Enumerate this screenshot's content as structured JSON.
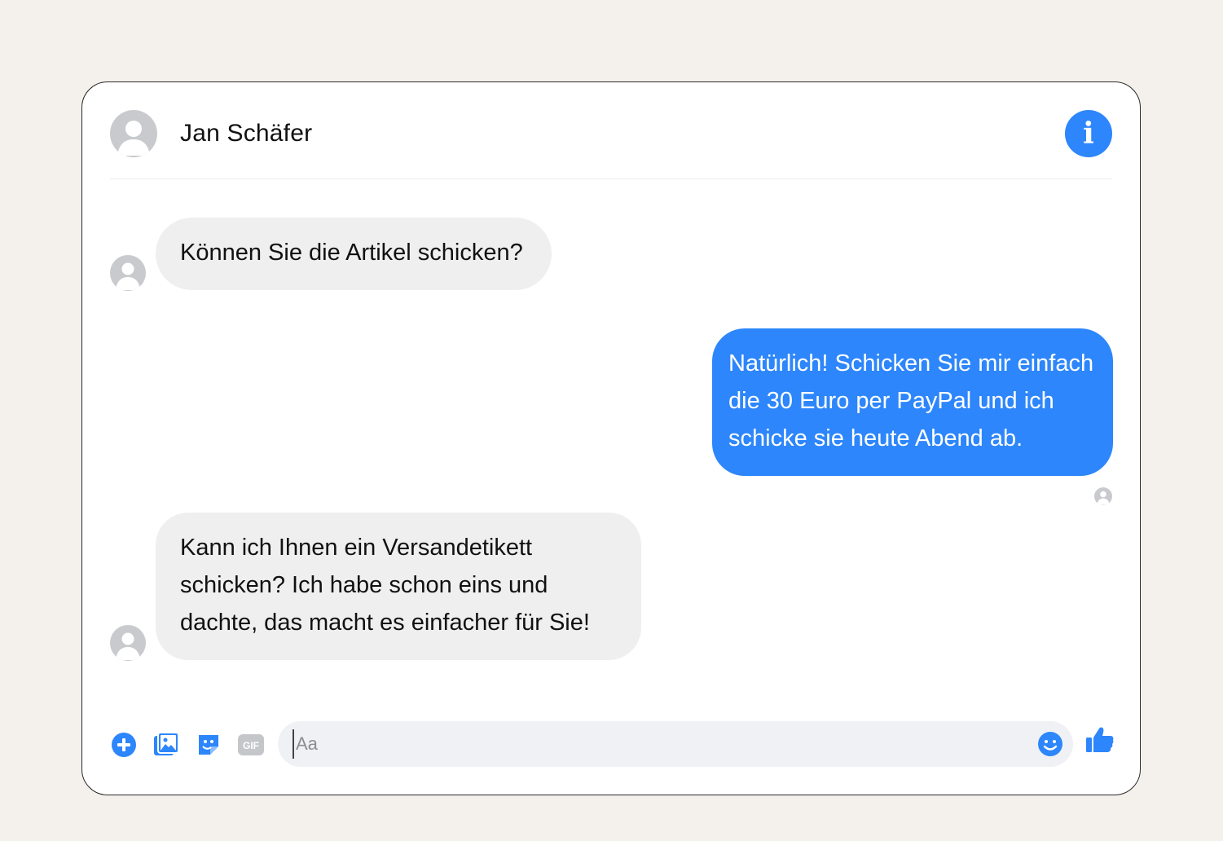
{
  "header": {
    "contact_name": "Jan Schäfer",
    "info_label": "i"
  },
  "messages": [
    {
      "direction": "incoming",
      "text": "Können Sie die Artikel schicken?"
    },
    {
      "direction": "outgoing",
      "text": "Natürlich! Schicken Sie mir einfach die 30 Euro per PayPal und ich schicke sie heute Abend ab."
    },
    {
      "direction": "incoming",
      "text": "Kann ich Ihnen ein Versandetikett schicken? Ich habe schon eins und dachte, das macht es einfacher für Sie!"
    }
  ],
  "composer": {
    "placeholder": "Aa",
    "gif_label": "GIF",
    "icons": [
      "plus-icon",
      "photo-icon",
      "sticker-icon",
      "gif-icon",
      "emoji-icon",
      "thumbs-up-icon"
    ]
  },
  "colors": {
    "accent": "#2d86fb",
    "incoming_bubble": "#efefef",
    "input_background": "#f0f1f4",
    "page_background": "#f4f1ec",
    "avatar_placeholder": "#c9cacd"
  }
}
